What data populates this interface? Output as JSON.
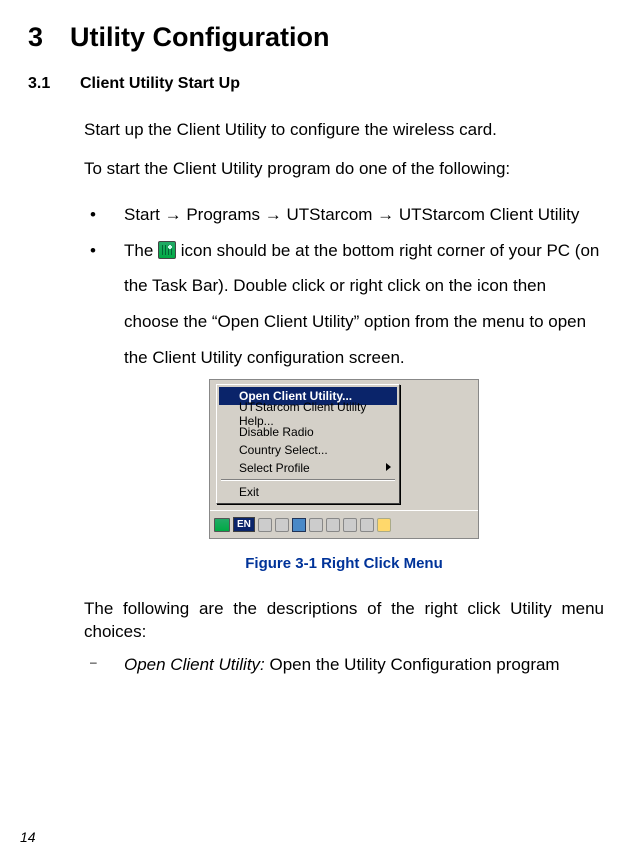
{
  "heading": {
    "num": "3",
    "title": "Utility Configuration"
  },
  "subheading": {
    "num": "3.1",
    "title": "Client Utility Start Up"
  },
  "para1": "Start up the Client Utility to configure the wireless card.",
  "para2": "To start the Client Utility program do one of the following:",
  "bullet1_parts": {
    "a": "Start ",
    "b": " Programs ",
    "c": " UTStarcom ",
    "d": " UTStarcom Client Utility"
  },
  "arrow": "→",
  "bullet2_parts": {
    "a": "The ",
    "b": " icon should be at the bottom right corner of your PC (on the Task Bar). Double click or right click on the icon then choose the “Open Client Utility” option from the menu to open the Client Utility configuration screen."
  },
  "menu": {
    "items": [
      "Open Client Utility...",
      "UTStarcom Client Utility Help...",
      "Disable Radio",
      "Country Select...",
      "Select Profile"
    ],
    "exit": "Exit",
    "lang": "EN"
  },
  "figure_caption": "Figure 3-1  Right Click Menu",
  "para3": "The following are the descriptions of the right click Utility menu choices:",
  "desc1_label": "Open Client Utility:",
  "desc1_text": " Open the Utility Configuration program",
  "page_number": "14"
}
